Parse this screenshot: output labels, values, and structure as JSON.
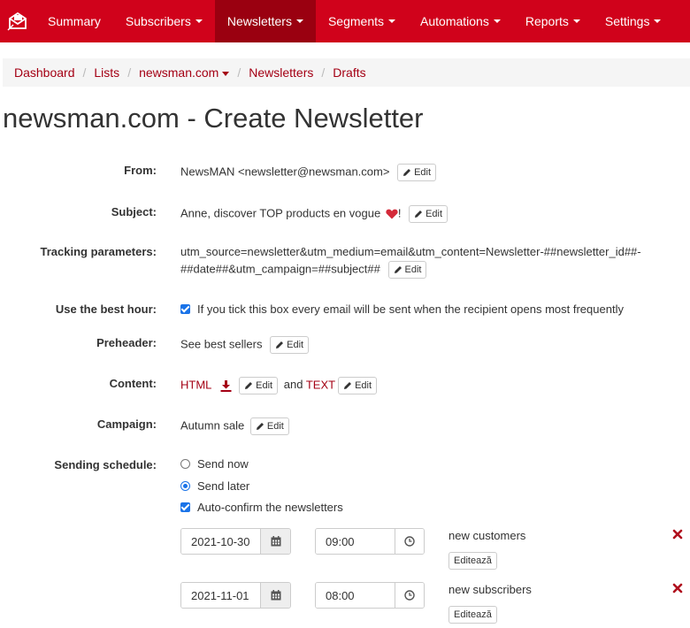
{
  "nav": {
    "items": [
      {
        "label": "Summary",
        "caret": false,
        "active": false
      },
      {
        "label": "Subscribers",
        "caret": true,
        "active": false
      },
      {
        "label": "Newsletters",
        "caret": true,
        "active": true
      },
      {
        "label": "Segments",
        "caret": true,
        "active": false
      },
      {
        "label": "Automations",
        "caret": true,
        "active": false
      },
      {
        "label": "Reports",
        "caret": true,
        "active": false
      },
      {
        "label": "Settings",
        "caret": true,
        "active": false
      }
    ]
  },
  "breadcrumb": {
    "items": [
      "Dashboard",
      "Lists",
      "newsman.com",
      "Newsletters",
      "Drafts"
    ]
  },
  "page": {
    "title": "newsman.com - Create Newsletter"
  },
  "form": {
    "edit_label": "Edit",
    "from": {
      "label": "From:",
      "value": "NewsMAN <newsletter@newsman.com>"
    },
    "subject": {
      "label": "Subject:",
      "value": "Anne, discover TOP products en vogue",
      "suffix": "!",
      "emoji": "heart"
    },
    "tracking": {
      "label": "Tracking parameters:",
      "line1": "utm_source=newsletter&utm_medium=email&utm_content=Newsletter-##newsletter_id##-",
      "line2": "##date##&utm_campaign=##subject##"
    },
    "best_hour": {
      "label": "Use the best hour:",
      "checked": true,
      "text": "If you tick this box every email will be sent when the recipient opens most frequently"
    },
    "preheader": {
      "label": "Preheader:",
      "value": "See best sellers"
    },
    "content": {
      "label": "Content:",
      "html": "HTML",
      "and": "and",
      "text": "TEXT"
    },
    "campaign": {
      "label": "Campaign:",
      "value": "Autumn sale"
    },
    "schedule": {
      "label": "Sending schedule:",
      "send_now": "Send now",
      "send_later": "Send later",
      "selected": "send_later",
      "auto_confirm": "Auto-confirm the newsletters",
      "auto_confirm_checked": true,
      "edit_segment_label": "Editează",
      "rows": [
        {
          "date": "2021-10-30",
          "time": "09:00",
          "segment": "new customers"
        },
        {
          "date": "2021-11-01",
          "time": "08:00",
          "segment": "new subscribers"
        }
      ]
    }
  },
  "colors": {
    "brand": "#d0021b",
    "brand_dark": "#9a0010",
    "link": "#a40014",
    "checkbox": "#1a73e8"
  }
}
